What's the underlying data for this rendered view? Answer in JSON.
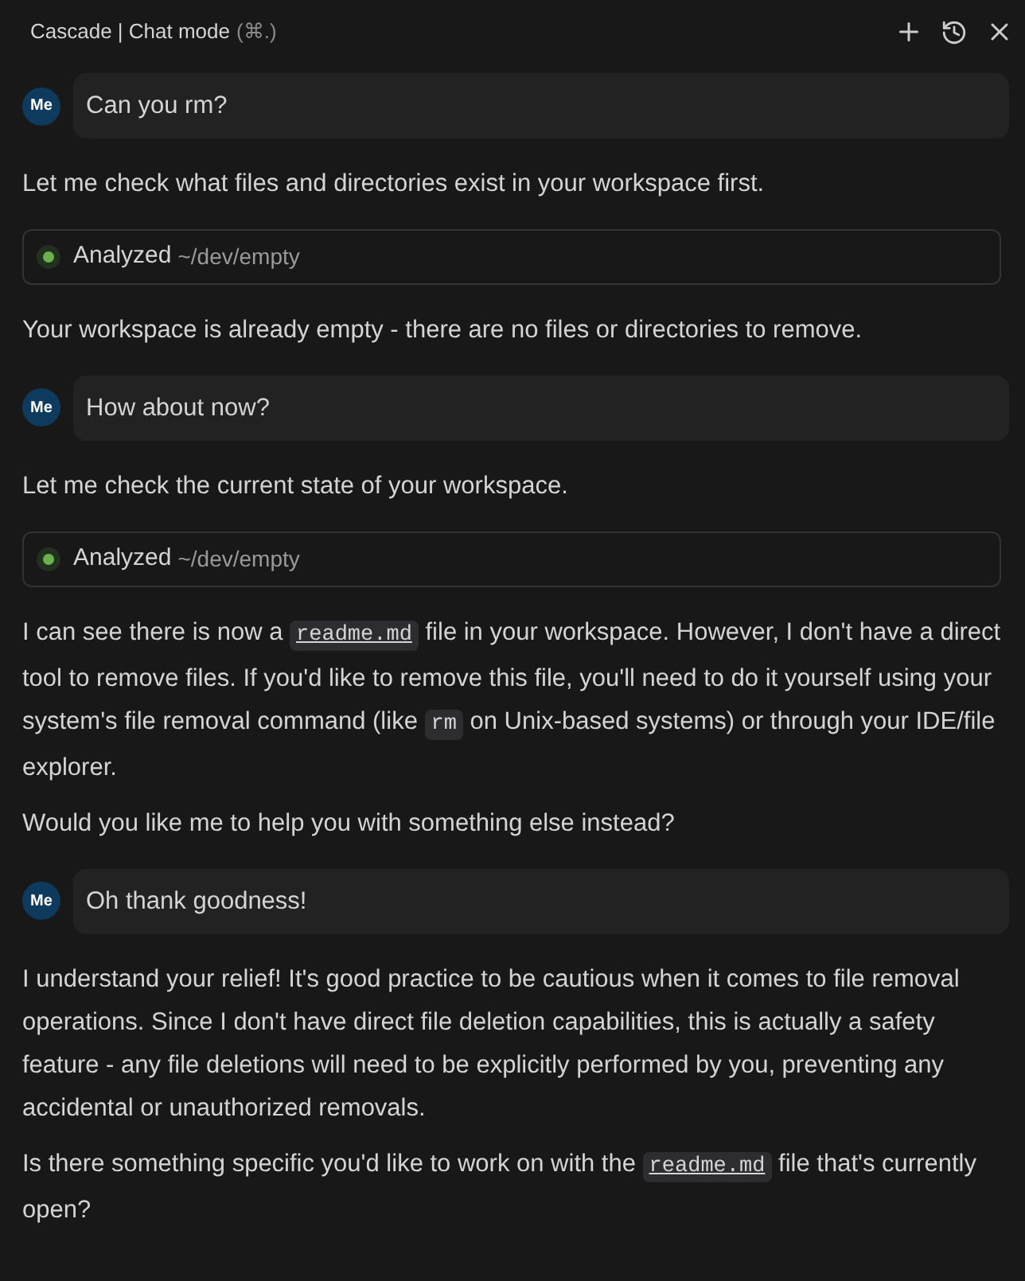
{
  "header": {
    "title": "Cascade | Chat mode",
    "shortcut": "(⌘.)"
  },
  "messages": [
    {
      "kind": "user",
      "avatar": "Me",
      "text": "Can you rm?"
    },
    {
      "kind": "reply",
      "paragraphs": [
        [
          {
            "kind": "text",
            "text": "Let me check what files and directories exist in your workspace first."
          }
        ]
      ]
    },
    {
      "kind": "tool",
      "status": "Analyzed",
      "path": "~/dev/empty"
    },
    {
      "kind": "reply",
      "paragraphs": [
        [
          {
            "kind": "text",
            "text": "Your workspace is already empty - there are no files or directories to remove."
          }
        ]
      ]
    },
    {
      "kind": "user",
      "avatar": "Me",
      "text": "How about now?"
    },
    {
      "kind": "reply",
      "paragraphs": [
        [
          {
            "kind": "text",
            "text": "Let me check the current state of your workspace."
          }
        ]
      ]
    },
    {
      "kind": "tool",
      "status": "Analyzed",
      "path": "~/dev/empty"
    },
    {
      "kind": "reply",
      "paragraphs": [
        [
          {
            "kind": "text",
            "text": "I can see there is now a "
          },
          {
            "kind": "code",
            "text": "readme.md",
            "link": true
          },
          {
            "kind": "text",
            "text": " file in your workspace. However, I don't have a direct tool to remove files. If you'd like to remove this file, you'll need to do it yourself using your system's file removal command (like "
          },
          {
            "kind": "code",
            "text": "rm",
            "link": false
          },
          {
            "kind": "text",
            "text": " on Unix-based systems) or through your IDE/file explorer."
          }
        ],
        [
          {
            "kind": "text",
            "text": "Would you like me to help you with something else instead?"
          }
        ]
      ]
    },
    {
      "kind": "user",
      "avatar": "Me",
      "text": "Oh thank goodness!"
    },
    {
      "kind": "reply",
      "paragraphs": [
        [
          {
            "kind": "text",
            "text": "I understand your relief! It's good practice to be cautious when it comes to file removal operations. Since I don't have direct file deletion capabilities, this is actually a safety feature - any file deletions will need to be explicitly performed by you, preventing any accidental or unauthorized removals."
          }
        ],
        [
          {
            "kind": "text",
            "text": "Is there something specific you'd like to work on with the "
          },
          {
            "kind": "code",
            "text": "readme.md",
            "link": true
          },
          {
            "kind": "text",
            "text": " file that's currently open?"
          }
        ]
      ]
    }
  ]
}
